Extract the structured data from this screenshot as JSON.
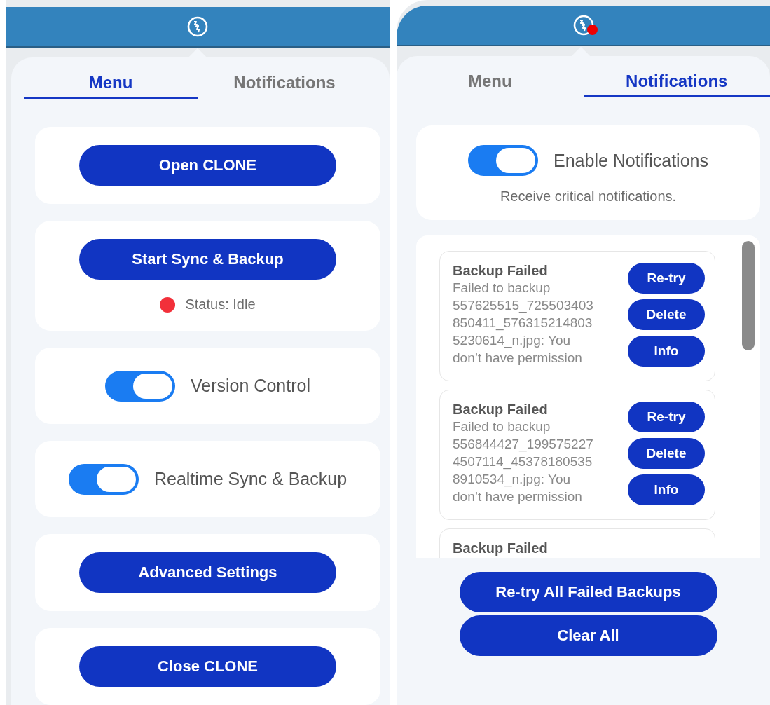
{
  "panels": [
    {
      "kind": "menu",
      "status_icon": {
        "badge": false
      },
      "tabs": [
        {
          "label": "Menu",
          "selected": true
        },
        {
          "label": "Notifications",
          "selected": false
        }
      ],
      "items": [
        {
          "kind": "button",
          "label": "Open CLONE"
        },
        {
          "kind": "button",
          "label": "Start Sync & Backup",
          "status": {
            "text": "Status: Idle",
            "color": "#f2303a"
          }
        },
        {
          "kind": "toggle",
          "label": "Version Control",
          "on": true
        },
        {
          "kind": "toggle",
          "label": "Realtime Sync & Backup",
          "on": true
        },
        {
          "kind": "button",
          "label": "Advanced Settings"
        },
        {
          "kind": "button",
          "label": "Close CLONE"
        }
      ]
    },
    {
      "kind": "notifications",
      "status_icon": {
        "badge": true
      },
      "tabs": [
        {
          "label": "Menu",
          "selected": false
        },
        {
          "label": "Notifications",
          "selected": true
        }
      ],
      "enable": {
        "label": "Enable Notifications",
        "on": true,
        "description": "Receive critical notifications."
      },
      "notifications": [
        {
          "title": "Backup Failed",
          "message": "Failed to backup 557625515_725503403850411_5763152148035230614_n.jpg: You don’t have permission",
          "actions": [
            "Re-try",
            "Delete",
            "Info"
          ]
        },
        {
          "title": "Backup Failed",
          "message": "Failed to backup 556844427_1995752274507114_453781805358910534_n.jpg: You don’t have permission",
          "actions": [
            "Re-try",
            "Delete",
            "Info"
          ]
        },
        {
          "title": "Backup Failed"
        }
      ],
      "footer_buttons": [
        "Re-try All Failed Backups",
        "Clear All"
      ]
    }
  ]
}
